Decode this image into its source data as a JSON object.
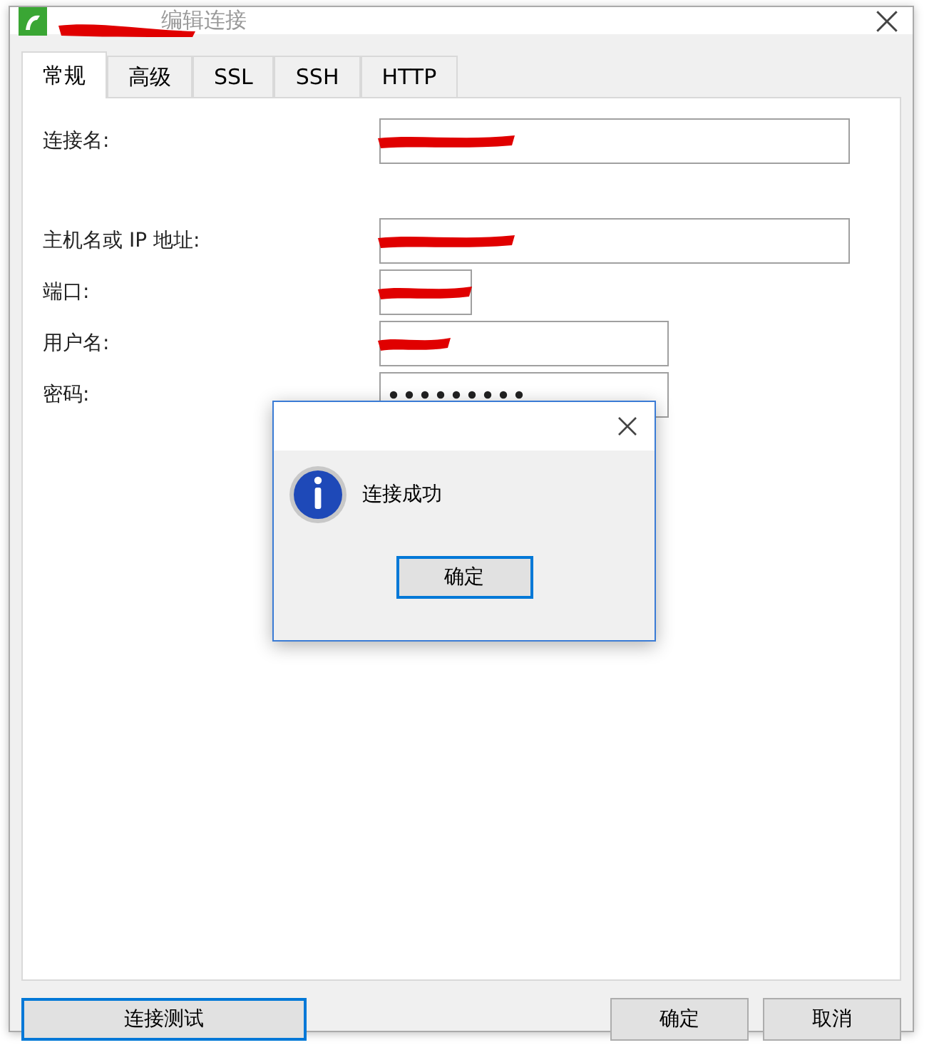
{
  "window": {
    "title": "编辑连接",
    "title_redacted": true
  },
  "tabs": [
    {
      "label": "常规",
      "selected": true
    },
    {
      "label": "高级",
      "selected": false
    },
    {
      "label": "SSL",
      "selected": false
    },
    {
      "label": "SSH",
      "selected": false
    },
    {
      "label": "HTTP",
      "selected": false
    }
  ],
  "fields": [
    {
      "label": "连接名:",
      "kind": "wide",
      "redacted": true,
      "masked": false,
      "gap_before": false
    },
    {
      "label": "主机名或 IP 地址:",
      "kind": "wide",
      "redacted": true,
      "masked": false,
      "gap_before": true
    },
    {
      "label": "端口:",
      "kind": "short",
      "redacted": true,
      "masked": false,
      "gap_before": false
    },
    {
      "label": "用户名:",
      "kind": "medium",
      "redacted": true,
      "masked": false,
      "gap_before": false
    },
    {
      "label": "密码:",
      "kind": "medium",
      "redacted": false,
      "masked": true,
      "gap_before": false
    }
  ],
  "buttons": {
    "test": "连接测试",
    "ok": "确定",
    "cancel": "取消"
  },
  "message_box": {
    "message": "连接成功",
    "button": "确定"
  }
}
